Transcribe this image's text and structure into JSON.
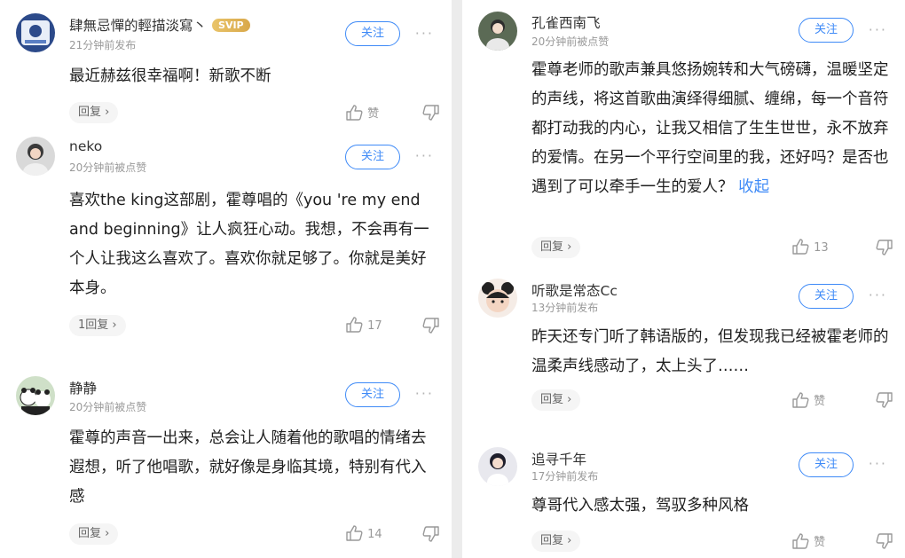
{
  "left": [
    {
      "username": "肆無忌憚的輕描淡寫丶",
      "badge": "SVIP",
      "meta": "21分钟前发布",
      "follow": "关注",
      "more": "···",
      "text": "最近赫兹很幸福啊！新歌不断",
      "reply": "回复 ›",
      "like": "赞"
    },
    {
      "username": "neko",
      "meta": "20分钟前被点赞",
      "follow": "关注",
      "more": "···",
      "text": "喜欢the king这部剧，霍尊唱的《you 're my end and beginning》让人疯狂心动。我想，不会再有一个人让我这么喜欢了。喜欢你就足够了。你就是美好本身。",
      "reply": "1回复 ›",
      "like": "17"
    },
    {
      "username": "静静",
      "meta": "20分钟前被点赞",
      "follow": "关注",
      "more": "···",
      "text": "霍尊的声音一出来，总会让人随着他的歌唱的情绪去遐想，听了他唱歌，就好像是身临其境，特别有代入感",
      "reply": "回复 ›",
      "like": "14"
    }
  ],
  "right": [
    {
      "username": "孔雀西南飞",
      "meta": "20分钟前被点赞",
      "follow": "关注",
      "more": "···",
      "text": "霍尊老师的歌声兼具悠扬婉转和大气磅礴，温暖坚定的声线，将这首歌曲演绎得细腻、缠绵，每一个音符都打动我的内心，让我又相信了生生世世，永不放弃的爱情。在另一个平行空间里的我，还好吗？是否也遇到了可以牵手一生的爱人？",
      "collapse": "收起",
      "reply": "回复 ›",
      "like": "13"
    },
    {
      "username": "听歌是常态Cc",
      "meta": "13分钟前发布",
      "follow": "关注",
      "more": "···",
      "text": "昨天还专门听了韩语版的，但发现我已经被霍老师的温柔声线感动了，太上头了……",
      "reply": "回复 ›",
      "like": "赞"
    },
    {
      "username": "追寻千年",
      "meta": "17分钟前发布",
      "follow": "关注",
      "more": "···",
      "text": "尊哥代入感太强，驾驭多种风格",
      "reply": "回复 ›",
      "like": "赞"
    }
  ],
  "icons": {
    "like": "thumbs-up-icon",
    "dislike": "thumbs-down-icon",
    "more": "more-dots-icon"
  },
  "colors": {
    "accent": "#3e8af7",
    "svip": "#d9a84a",
    "meta": "#999999"
  }
}
